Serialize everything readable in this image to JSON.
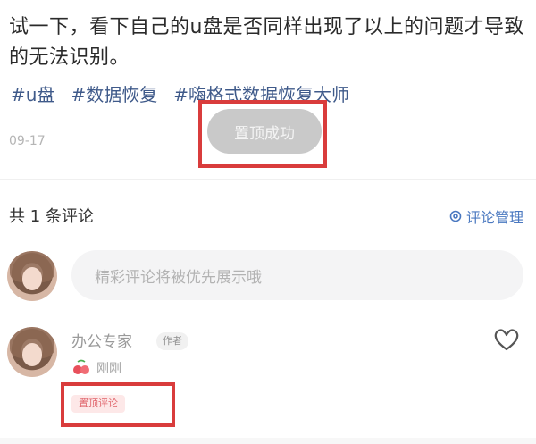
{
  "post": {
    "body": "试一下，看下自己的u盘是否同样出现了以上的问题才导致的无法识别。",
    "hashtags": [
      "#u盘",
      "#数据恢复",
      "#嗨格式数据恢复大师"
    ],
    "date": "09-17"
  },
  "toast": {
    "text": "置顶成功"
  },
  "comments_header": {
    "count_label": "共 1 条评论",
    "manage_label": "评论管理",
    "manage_icon": "gear-icon"
  },
  "comment_input": {
    "placeholder": "精彩评论将被优先展示哦"
  },
  "comment": {
    "author": "办公专家",
    "author_tag": "作者",
    "time": "刚刚",
    "pinned_label": "置顶评论",
    "like_icon": "heart-outline-icon",
    "accent_color": "#d93c3c"
  }
}
